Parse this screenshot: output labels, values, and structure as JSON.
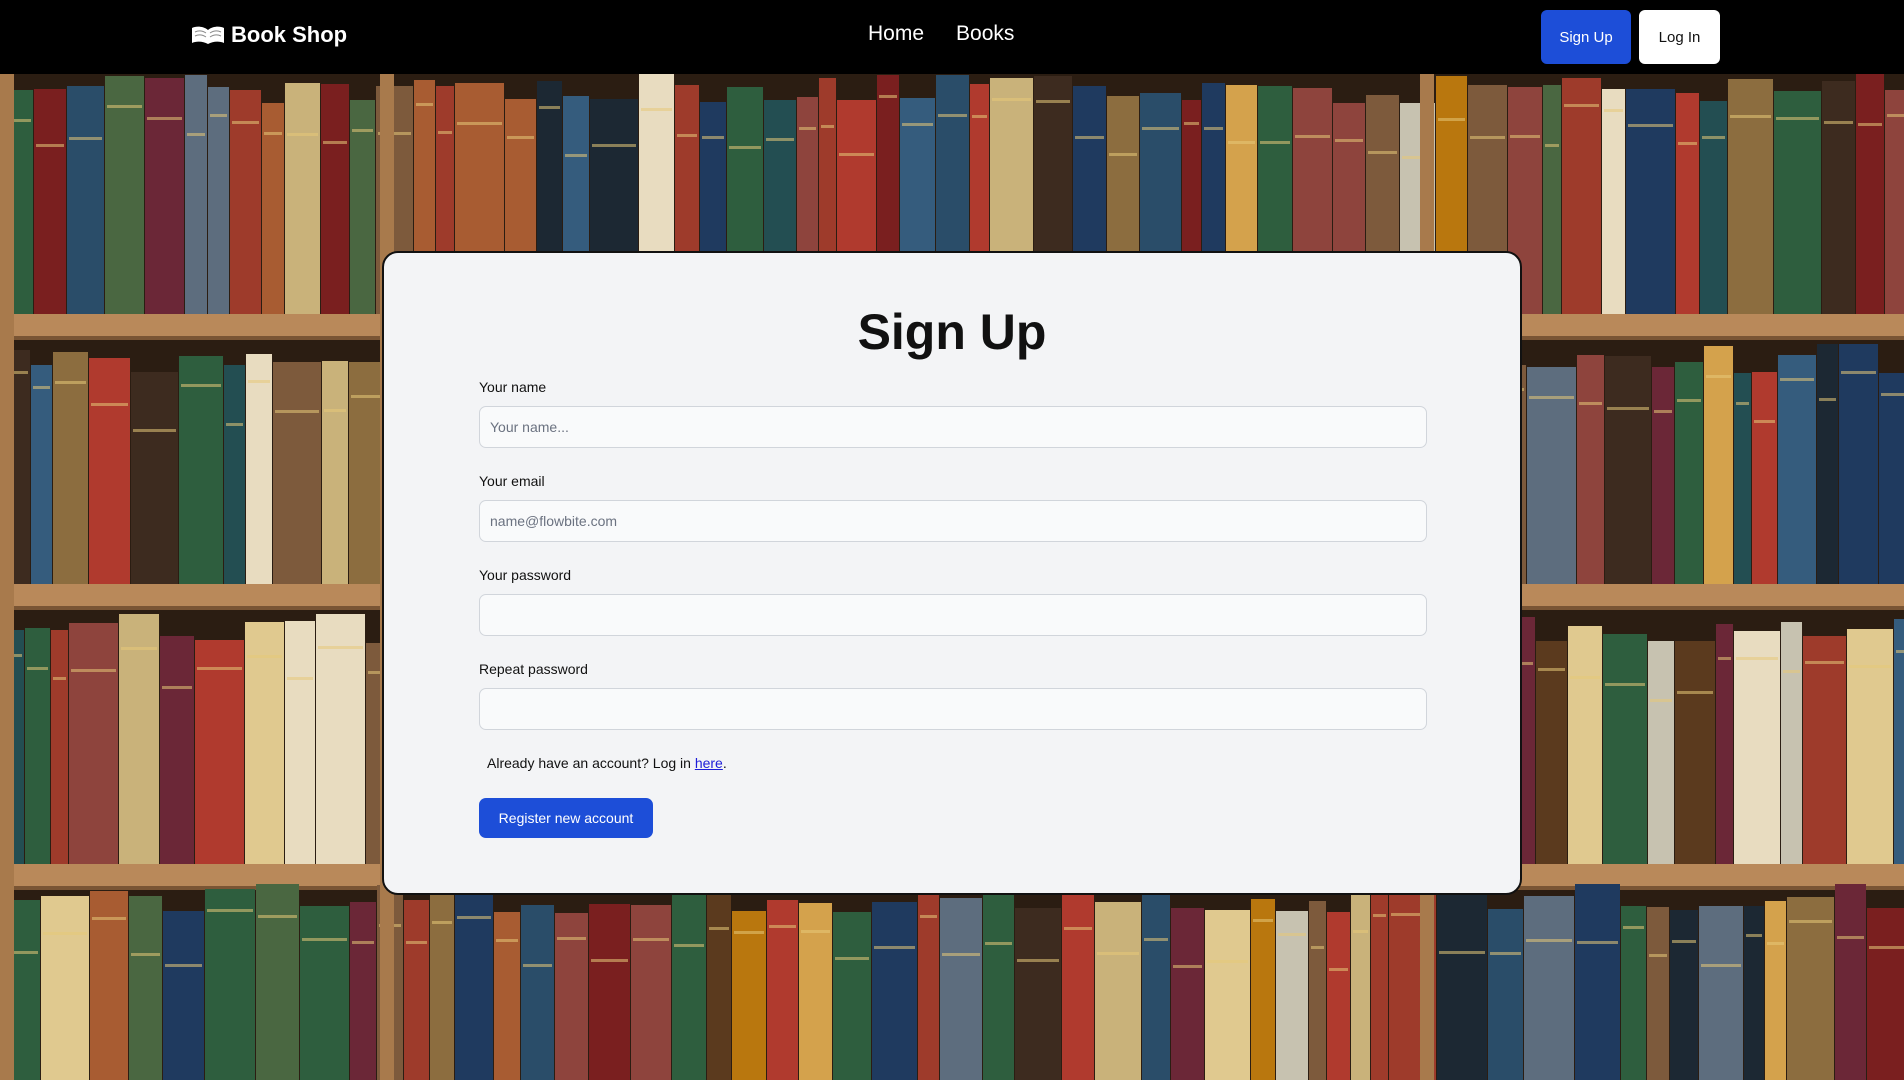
{
  "nav": {
    "brand": "Book Shop",
    "links": [
      "Home",
      "Books"
    ],
    "signup_label": "Sign Up",
    "login_label": "Log In"
  },
  "form": {
    "title": "Sign Up",
    "name_label": "Your name",
    "name_placeholder": "Your name...",
    "email_label": "Your email",
    "email_placeholder": "name@flowbite.com",
    "password_label": "Your password",
    "repeat_label": "Repeat password",
    "login_hint_prefix": "Already have an account? Log in ",
    "login_hint_link": "here",
    "login_hint_suffix": ".",
    "register_label": "Register new account"
  },
  "colors": {
    "primary": "#1d4ed8",
    "navbar": "#000000",
    "card": "#f3f4f6"
  }
}
